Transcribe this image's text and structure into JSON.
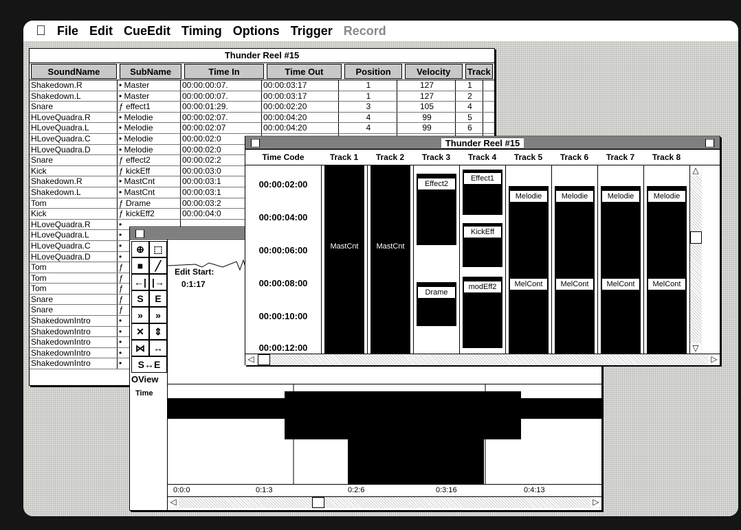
{
  "menubar": {
    "apple_icon": "apple-logo",
    "items": [
      {
        "label": "File",
        "dim": false
      },
      {
        "label": "Edit",
        "dim": false
      },
      {
        "label": "CueEdit",
        "dim": false
      },
      {
        "label": "Timing",
        "dim": false
      },
      {
        "label": "Options",
        "dim": false
      },
      {
        "label": "Trigger",
        "dim": false
      },
      {
        "label": "Record",
        "dim": true
      }
    ]
  },
  "cue_window": {
    "title": "Thunder Reel #15",
    "columns": [
      "SoundName",
      "SubName",
      "Time In",
      "Time Out",
      "Position",
      "Velocity",
      "Track"
    ],
    "rows": [
      [
        "Shakedown.R",
        "•  Master",
        "00:00:00:07.",
        "00:00:03:17",
        "1",
        "127",
        "1"
      ],
      [
        "Shakedown.L",
        "•  Master",
        "00:00:00:07.",
        "00:00:03:17",
        "1",
        "127",
        "2"
      ],
      [
        "Snare",
        "ƒ  effect1",
        "00:00:01:29.",
        "00:00:02:20",
        "3",
        "105",
        "4"
      ],
      [
        "HLoveQuadra.R",
        "•  Melodie",
        "00:00:02:07.",
        "00:00:04:20",
        "4",
        "99",
        "5"
      ],
      [
        "HLoveQuadra.L",
        "•  Melodie",
        "00:00:02:07",
        "00:00:04:20",
        "4",
        "99",
        "6"
      ],
      [
        "HLoveQuadra.C",
        "•  Melodie",
        "00:00:02:0",
        "",
        "",
        "",
        ""
      ],
      [
        "HLoveQuadra.D",
        "•  Melodie",
        "00:00:02:0",
        "",
        "",
        "",
        ""
      ],
      [
        "Snare",
        "ƒ  effect2",
        "00:00:02:2",
        "",
        "",
        "",
        ""
      ],
      [
        "Kick",
        "ƒ  kickEff",
        "00:00:03:0",
        "",
        "",
        "",
        ""
      ],
      [
        "Shakedown.R",
        "•  MastCnt",
        "00:00:03:1",
        "",
        "",
        "",
        ""
      ],
      [
        "Shakedown.L",
        "•  MastCnt",
        "00:00:03:1",
        "",
        "",
        "",
        ""
      ],
      [
        "Tom",
        "ƒ  Drame",
        "00:00:03:2",
        "",
        "",
        "",
        ""
      ],
      [
        "Kick",
        "ƒ  kickEff2",
        "00:00:04:0",
        "",
        "",
        "",
        ""
      ],
      [
        "HLoveQuadra.R",
        "•",
        "",
        "",
        "",
        "",
        ""
      ],
      [
        "HLoveQuadra.L",
        "•",
        "",
        "",
        "",
        "",
        ""
      ],
      [
        "HLoveQuadra.C",
        "•",
        "",
        "",
        "",
        "",
        ""
      ],
      [
        "HLoveQuadra.D",
        "•",
        "",
        "",
        "",
        "",
        ""
      ],
      [
        "Tom",
        "ƒ",
        "",
        "",
        "",
        "",
        ""
      ],
      [
        "Tom",
        "ƒ",
        "",
        "",
        "",
        "",
        ""
      ],
      [
        "Tom",
        "ƒ",
        "",
        "",
        "",
        "",
        ""
      ],
      [
        "Snare",
        "ƒ",
        "",
        "",
        "",
        "",
        ""
      ],
      [
        "Snare",
        "ƒ",
        "",
        "",
        "",
        "",
        ""
      ],
      [
        "ShakedownIntro",
        "•",
        "",
        "",
        "",
        "",
        ""
      ],
      [
        "ShakedownIntro",
        "•",
        "",
        "",
        "",
        "",
        ""
      ],
      [
        "ShakedownIntro",
        "•",
        "",
        "",
        "",
        "",
        ""
      ],
      [
        "ShakedownIntro",
        "•",
        "",
        "",
        "",
        "",
        ""
      ],
      [
        "ShakedownIntro",
        "•",
        "",
        "",
        "",
        "",
        ""
      ]
    ]
  },
  "track_window": {
    "title": "Thunder Reel #15",
    "timecode_header": "Time Code",
    "timecodes": [
      "00:00:02:00",
      "00:00:04:00",
      "00:00:06:00",
      "00:00:08:00",
      "00:00:10:00",
      "00:00:12:00"
    ],
    "tracks": [
      {
        "name": "Track 1",
        "labels": [
          "MastCnt"
        ]
      },
      {
        "name": "Track 2",
        "labels": [
          "MastCnt"
        ]
      },
      {
        "name": "Track 3",
        "labels": [
          "Effect2",
          "Drame"
        ]
      },
      {
        "name": "Track 4",
        "labels": [
          "Effect1",
          "KickEff",
          "modEff2"
        ]
      },
      {
        "name": "Track 5",
        "labels": [
          "Melodie",
          "MelCont"
        ]
      },
      {
        "name": "Track 6",
        "labels": [
          "Melodie",
          "MelCont"
        ]
      },
      {
        "name": "Track 7",
        "labels": [
          "Melodie",
          "MelCont"
        ]
      },
      {
        "name": "Track 8",
        "labels": [
          "Melodie",
          "MelCont"
        ]
      }
    ]
  },
  "editor_window": {
    "edit_start_label": "Edit Start:",
    "edit_start_value": "0:1:17",
    "overview_label": "OView",
    "time_label": "Time",
    "ruler": [
      "0:0:0",
      "0:1:3",
      "0:2:6",
      "0:3:16",
      "0:4:13"
    ],
    "tool_icons": [
      "crosshair-icon",
      "marquee-icon",
      "fill-icon",
      "line-icon",
      "left-bound-icon",
      "right-bound-icon",
      "s-icon",
      "e-icon",
      "fast-forward-icon",
      "skip-icon",
      "compress-icon",
      "expand-icon",
      "zoom-in-icon",
      "zoom-out-icon",
      "start-end-icon"
    ]
  }
}
